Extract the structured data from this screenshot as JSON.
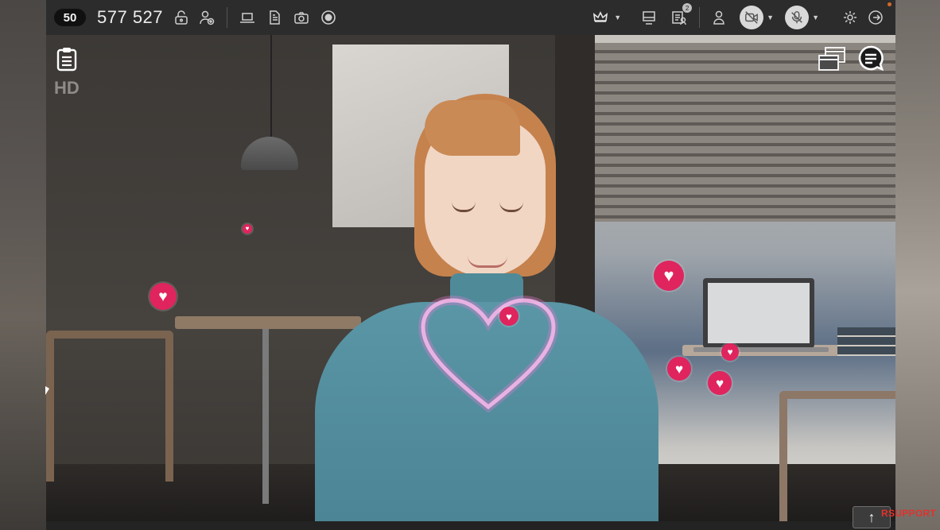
{
  "toolbar": {
    "participant_count": "50",
    "session_id": "577 527",
    "icons": {
      "lock": "lock-icon",
      "add_user": "add-user-icon",
      "screen_share": "laptop-icon",
      "document": "document-icon",
      "camera": "camera-icon",
      "record": "record-icon",
      "host": "crown-icon",
      "whiteboard": "monitor-icon",
      "participants": "participants-list-icon",
      "user_settings": "user-settings-icon",
      "video_off": "video-off-icon",
      "mic_off": "mic-off-icon",
      "settings": "gear-icon",
      "exit": "exit-icon"
    },
    "participants_counter": "2"
  },
  "overlay": {
    "quality_label": "HD"
  },
  "footer": {
    "scroll_up_symbol": "↑",
    "brand_text": "RSUPPORT"
  },
  "colors": {
    "toolbar_bg": "#2c2c2c",
    "heart_color": "#e0245e",
    "brand_red": "#e0322c"
  }
}
